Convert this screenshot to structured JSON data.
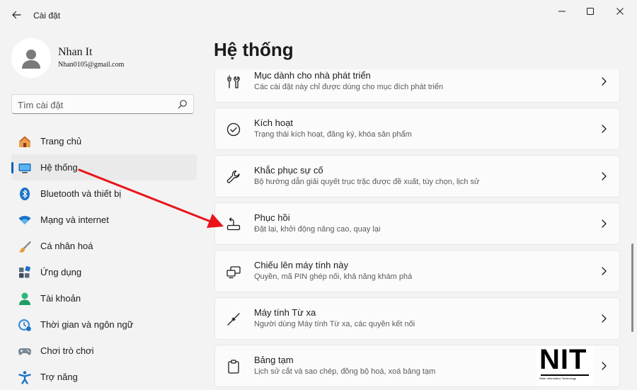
{
  "window": {
    "title": "Cài đặt"
  },
  "user": {
    "name": "Nhan It",
    "email": "Nhan0105@gmail.com"
  },
  "search": {
    "placeholder": "Tìm cài đặt"
  },
  "sidebar": {
    "items": [
      {
        "label": "Trang chủ",
        "icon": "home-icon"
      },
      {
        "label": "Hệ thống",
        "icon": "system-icon",
        "active": true
      },
      {
        "label": "Bluetooth và thiết bị",
        "icon": "bluetooth-icon"
      },
      {
        "label": "Mạng và internet",
        "icon": "wifi-icon"
      },
      {
        "label": "Cá nhân hoá",
        "icon": "brush-icon"
      },
      {
        "label": "Ứng dụng",
        "icon": "apps-icon"
      },
      {
        "label": "Tài khoản",
        "icon": "account-icon"
      },
      {
        "label": "Thời gian và ngôn ngữ",
        "icon": "clock-globe-icon"
      },
      {
        "label": "Chơi trò chơi",
        "icon": "gamepad-icon"
      },
      {
        "label": "Trợ năng",
        "icon": "accessibility-icon"
      }
    ]
  },
  "main": {
    "title": "Hệ thống",
    "cards": [
      {
        "title": "Mục dành cho nhà phát triển",
        "subtitle": "Các cài đặt này chỉ được dùng cho mục đích phát triển",
        "icon": "developer-tools-icon"
      },
      {
        "title": "Kích hoạt",
        "subtitle": "Trạng thái kích hoạt, đăng ký, khóa sản phẩm",
        "icon": "check-circle-icon"
      },
      {
        "title": "Khắc phục sự cố",
        "subtitle": "Bộ hướng dẫn giải quyết trục trặc được đề xuất, tùy chọn, lịch sử",
        "icon": "wrench-icon"
      },
      {
        "title": "Phục hồi",
        "subtitle": "Đặt lại, khởi động nâng cao, quay lại",
        "icon": "recovery-icon"
      },
      {
        "title": "Chiếu lên máy tính này",
        "subtitle": "Quyền, mã PIN ghép nối, khả năng khám phá",
        "icon": "project-icon"
      },
      {
        "title": "Máy tính Từ xa",
        "subtitle": "Người dùng Máy tính Từ xa, các quyền kết nối",
        "icon": "remote-desktop-icon"
      },
      {
        "title": "Bảng tạm",
        "subtitle": "Lịch sử cắt và sao chép, đồng bộ hoá, xoá bảng tạm",
        "icon": "clipboard-icon"
      }
    ]
  },
  "watermark": {
    "logo_text": "NIT",
    "sub_text": "Nhân Information Technology"
  },
  "colors": {
    "accent": "#005fb8",
    "annotation_arrow": "#e8141a"
  }
}
